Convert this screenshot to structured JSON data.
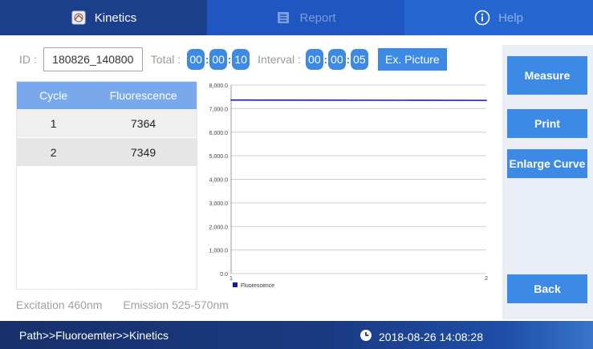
{
  "tabs": [
    {
      "label": "Kinetics",
      "icon": "chart-icon"
    },
    {
      "label": "Report",
      "icon": "report-icon"
    },
    {
      "label": "Help",
      "icon": "info-icon"
    }
  ],
  "toolbar": {
    "id_label": "ID :",
    "id_value": "180826_140800",
    "total_label": "Total :",
    "total": [
      "00",
      "00",
      "10"
    ],
    "interval_label": "Interval :",
    "interval": [
      "00",
      "00",
      "05"
    ],
    "ex_picture_label": "Ex. Picture"
  },
  "table": {
    "headers": [
      "Cycle",
      "Fluorescence"
    ],
    "rows": [
      [
        "1",
        "7364"
      ],
      [
        "2",
        "7349"
      ]
    ]
  },
  "chart_data": {
    "type": "line",
    "x": [
      1,
      2
    ],
    "series": [
      {
        "name": "Fluorescence",
        "values": [
          7364,
          7349
        ]
      }
    ],
    "ylim": [
      0,
      8000
    ],
    "yticks": [
      "0.0",
      "1,000.0",
      "2,000.0",
      "3,000.0",
      "4,000.0",
      "5,000.0",
      "6,000.0",
      "7,000.0",
      "8,000.0"
    ],
    "xticks": [
      "1",
      "2"
    ],
    "grid": true,
    "legend": "bottom-left"
  },
  "buttons": {
    "measure": "Measure",
    "print": "Print",
    "enlarge": "Enlarge Curve",
    "back": "Back"
  },
  "info": {
    "excitation": "Excitation 460nm",
    "emission": "Emission 525-570nm"
  },
  "status": {
    "path": "Path>>Fluoroemter>>Kinetics",
    "datetime": "2018-08-26 14:08:28"
  },
  "colors": {
    "accent": "#3d8ae6",
    "header_blue": "#1c3f8c",
    "series_line": "#1a1aa0"
  }
}
